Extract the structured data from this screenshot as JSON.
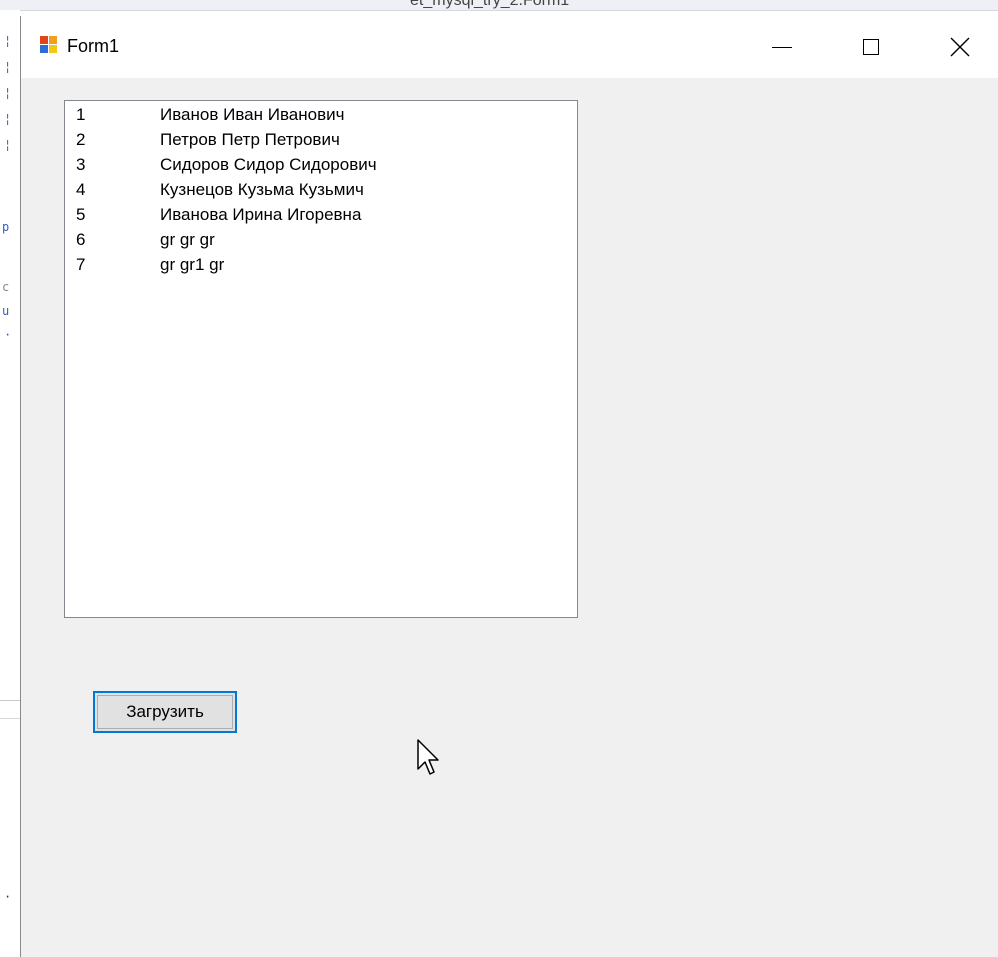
{
  "background": {
    "title_fragment": "et_mysql_try_2.Form1"
  },
  "window": {
    "title": "Form1",
    "controls": {
      "minimize": "minimize",
      "maximize": "maximize",
      "close": "close"
    }
  },
  "listbox": {
    "items": [
      {
        "id": "1",
        "name": "Иванов Иван Иванович"
      },
      {
        "id": "2",
        "name": "Петров Петр Петрович"
      },
      {
        "id": "3",
        "name": "Сидоров Сидор Сидорович"
      },
      {
        "id": "4",
        "name": "Кузнецов Кузьма Кузьмич"
      },
      {
        "id": "5",
        "name": "Иванова Ирина Игоревна"
      },
      {
        "id": "6",
        "name": "gr gr gr"
      },
      {
        "id": "7",
        "name": "gr gr1 gr"
      }
    ]
  },
  "load_button": {
    "label": "Загрузить"
  },
  "colors": {
    "accent": "#0078d7",
    "window_bg": "#f0f0f0",
    "titlebar_bg": "#ffffff"
  },
  "icons": {
    "app": "winforms-app-icon",
    "minimize": "minimize-icon",
    "maximize": "maximize-icon",
    "close": "close-icon",
    "cursor": "mouse-pointer-icon"
  }
}
